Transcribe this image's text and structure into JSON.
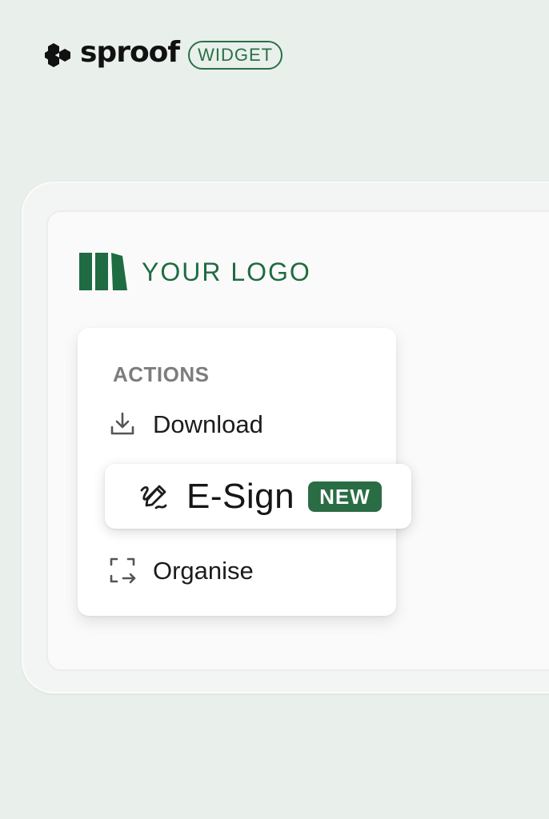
{
  "brand": {
    "name": "sproof",
    "badge": "WIDGET",
    "icon": "hexagon-cluster-icon",
    "color": "#2a6f46"
  },
  "client_logo": {
    "text": "YOUR LOGO",
    "icon": "bars-logo-icon",
    "color": "#1f6b42"
  },
  "menu": {
    "heading": "ACTIONS",
    "items": [
      {
        "label": "Download",
        "icon": "download-icon"
      },
      {
        "label": "E-Sign",
        "icon": "signature-pen-icon",
        "badge": "NEW",
        "highlighted": true
      },
      {
        "label": "Organise",
        "icon": "organise-icon"
      }
    ]
  },
  "colors": {
    "background": "#e9efeb",
    "accent": "#2a6c44"
  }
}
